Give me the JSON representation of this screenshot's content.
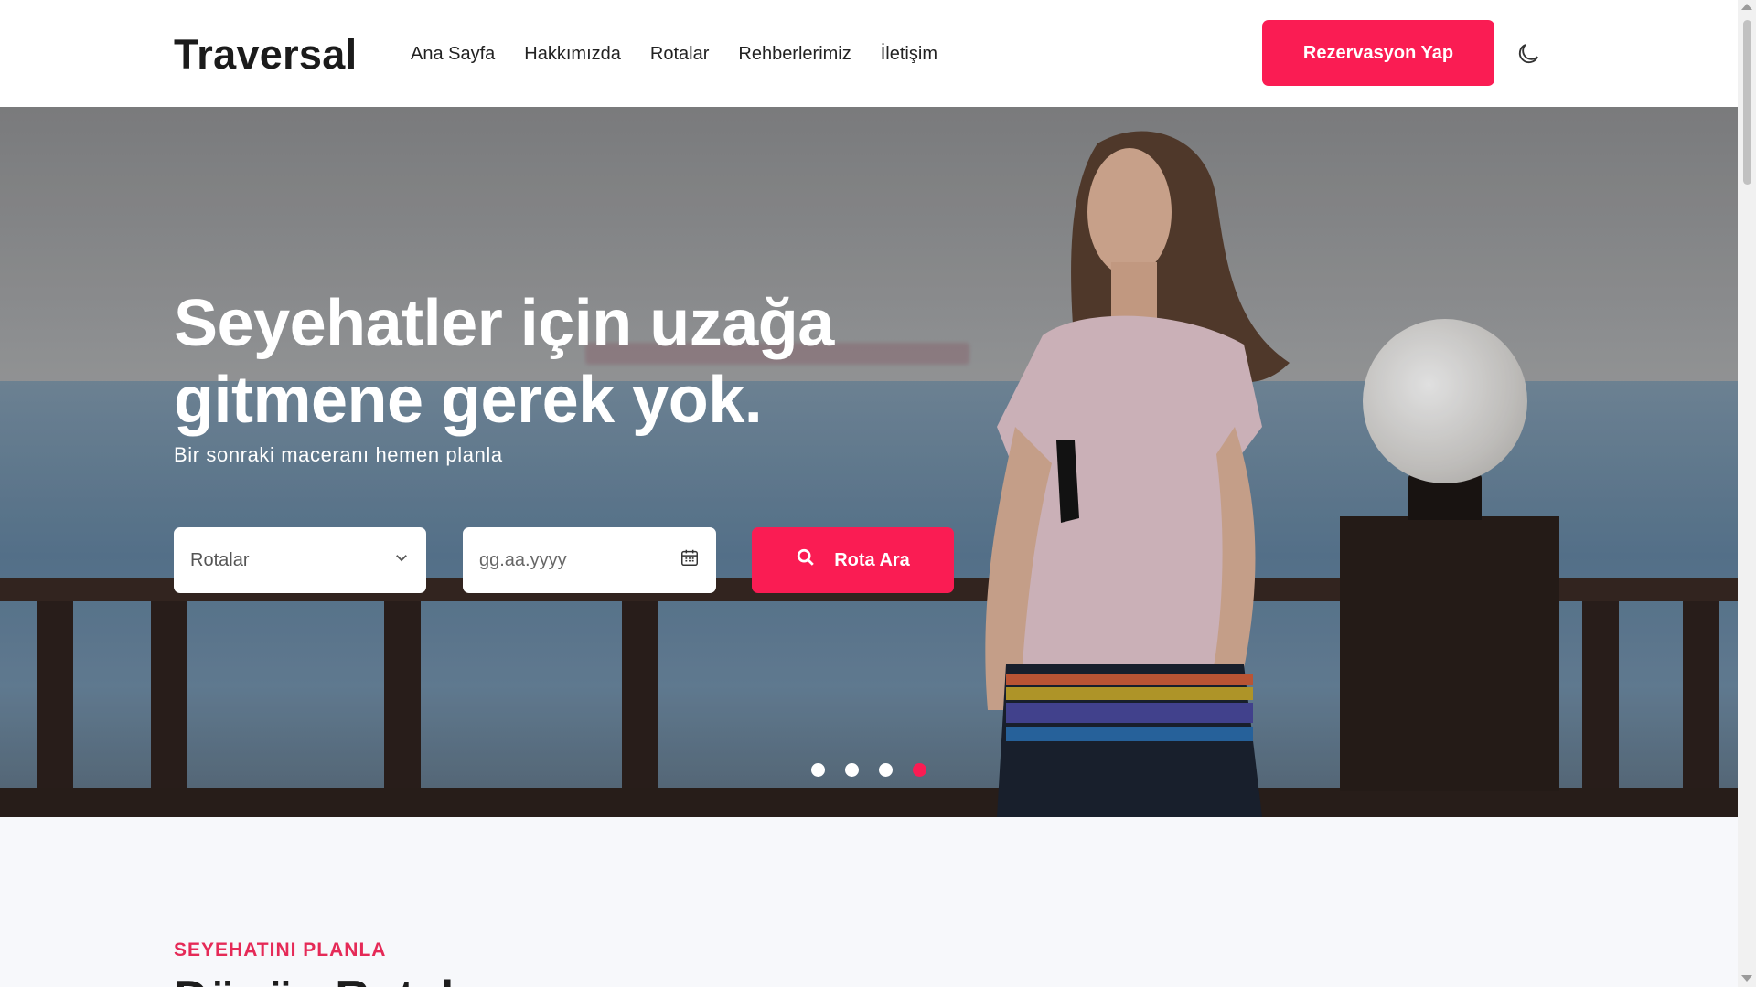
{
  "header": {
    "logo": "Traversal",
    "nav": [
      "Ana Sayfa",
      "Hakkımızda",
      "Rotalar",
      "Rehberlerimiz",
      "İletişim"
    ],
    "cta_label": "Rezervasyon Yap",
    "theme_icon": "moon-icon"
  },
  "hero": {
    "title": "Seyehatler için uzağa gitmene gerek yok.",
    "subtitle": "Bir sonraki maceranı hemen planla",
    "route_select": {
      "value": "Rotalar",
      "icon": "chevron-down-icon"
    },
    "date_input": {
      "placeholder": "gg.aa.yyyy",
      "icon": "calendar-icon"
    },
    "search_button": {
      "label": "Rota Ara",
      "icon": "search-icon"
    },
    "carousel": {
      "slides": 4,
      "active_index": 3
    }
  },
  "section": {
    "eyebrow": "SEYEHATINI PLANLA",
    "title": "Dönüş Rotaları"
  },
  "colors": {
    "accent": "#fa1c53",
    "eyebrow": "#e52a57"
  }
}
